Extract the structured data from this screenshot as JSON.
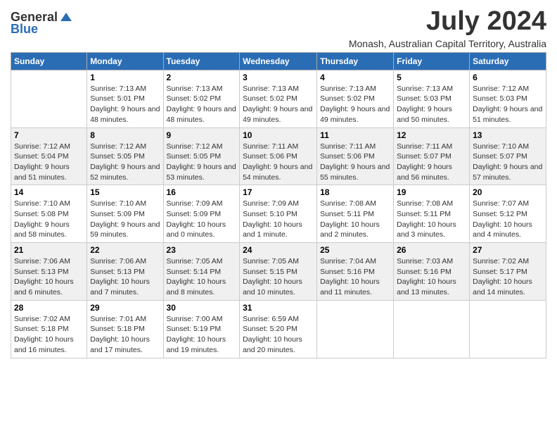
{
  "logo": {
    "general": "General",
    "blue": "Blue"
  },
  "title": "July 2024",
  "subtitle": "Monash, Australian Capital Territory, Australia",
  "days_of_week": [
    "Sunday",
    "Monday",
    "Tuesday",
    "Wednesday",
    "Thursday",
    "Friday",
    "Saturday"
  ],
  "weeks": [
    [
      {
        "day": "",
        "sunrise": "",
        "sunset": "",
        "daylight": ""
      },
      {
        "day": "1",
        "sunrise": "Sunrise: 7:13 AM",
        "sunset": "Sunset: 5:01 PM",
        "daylight": "Daylight: 9 hours and 48 minutes."
      },
      {
        "day": "2",
        "sunrise": "Sunrise: 7:13 AM",
        "sunset": "Sunset: 5:02 PM",
        "daylight": "Daylight: 9 hours and 48 minutes."
      },
      {
        "day": "3",
        "sunrise": "Sunrise: 7:13 AM",
        "sunset": "Sunset: 5:02 PM",
        "daylight": "Daylight: 9 hours and 49 minutes."
      },
      {
        "day": "4",
        "sunrise": "Sunrise: 7:13 AM",
        "sunset": "Sunset: 5:02 PM",
        "daylight": "Daylight: 9 hours and 49 minutes."
      },
      {
        "day": "5",
        "sunrise": "Sunrise: 7:13 AM",
        "sunset": "Sunset: 5:03 PM",
        "daylight": "Daylight: 9 hours and 50 minutes."
      },
      {
        "day": "6",
        "sunrise": "Sunrise: 7:12 AM",
        "sunset": "Sunset: 5:03 PM",
        "daylight": "Daylight: 9 hours and 51 minutes."
      }
    ],
    [
      {
        "day": "7",
        "sunrise": "Sunrise: 7:12 AM",
        "sunset": "Sunset: 5:04 PM",
        "daylight": "Daylight: 9 hours and 51 minutes."
      },
      {
        "day": "8",
        "sunrise": "Sunrise: 7:12 AM",
        "sunset": "Sunset: 5:05 PM",
        "daylight": "Daylight: 9 hours and 52 minutes."
      },
      {
        "day": "9",
        "sunrise": "Sunrise: 7:12 AM",
        "sunset": "Sunset: 5:05 PM",
        "daylight": "Daylight: 9 hours and 53 minutes."
      },
      {
        "day": "10",
        "sunrise": "Sunrise: 7:11 AM",
        "sunset": "Sunset: 5:06 PM",
        "daylight": "Daylight: 9 hours and 54 minutes."
      },
      {
        "day": "11",
        "sunrise": "Sunrise: 7:11 AM",
        "sunset": "Sunset: 5:06 PM",
        "daylight": "Daylight: 9 hours and 55 minutes."
      },
      {
        "day": "12",
        "sunrise": "Sunrise: 7:11 AM",
        "sunset": "Sunset: 5:07 PM",
        "daylight": "Daylight: 9 hours and 56 minutes."
      },
      {
        "day": "13",
        "sunrise": "Sunrise: 7:10 AM",
        "sunset": "Sunset: 5:07 PM",
        "daylight": "Daylight: 9 hours and 57 minutes."
      }
    ],
    [
      {
        "day": "14",
        "sunrise": "Sunrise: 7:10 AM",
        "sunset": "Sunset: 5:08 PM",
        "daylight": "Daylight: 9 hours and 58 minutes."
      },
      {
        "day": "15",
        "sunrise": "Sunrise: 7:10 AM",
        "sunset": "Sunset: 5:09 PM",
        "daylight": "Daylight: 9 hours and 59 minutes."
      },
      {
        "day": "16",
        "sunrise": "Sunrise: 7:09 AM",
        "sunset": "Sunset: 5:09 PM",
        "daylight": "Daylight: 10 hours and 0 minutes."
      },
      {
        "day": "17",
        "sunrise": "Sunrise: 7:09 AM",
        "sunset": "Sunset: 5:10 PM",
        "daylight": "Daylight: 10 hours and 1 minute."
      },
      {
        "day": "18",
        "sunrise": "Sunrise: 7:08 AM",
        "sunset": "Sunset: 5:11 PM",
        "daylight": "Daylight: 10 hours and 2 minutes."
      },
      {
        "day": "19",
        "sunrise": "Sunrise: 7:08 AM",
        "sunset": "Sunset: 5:11 PM",
        "daylight": "Daylight: 10 hours and 3 minutes."
      },
      {
        "day": "20",
        "sunrise": "Sunrise: 7:07 AM",
        "sunset": "Sunset: 5:12 PM",
        "daylight": "Daylight: 10 hours and 4 minutes."
      }
    ],
    [
      {
        "day": "21",
        "sunrise": "Sunrise: 7:06 AM",
        "sunset": "Sunset: 5:13 PM",
        "daylight": "Daylight: 10 hours and 6 minutes."
      },
      {
        "day": "22",
        "sunrise": "Sunrise: 7:06 AM",
        "sunset": "Sunset: 5:13 PM",
        "daylight": "Daylight: 10 hours and 7 minutes."
      },
      {
        "day": "23",
        "sunrise": "Sunrise: 7:05 AM",
        "sunset": "Sunset: 5:14 PM",
        "daylight": "Daylight: 10 hours and 8 minutes."
      },
      {
        "day": "24",
        "sunrise": "Sunrise: 7:05 AM",
        "sunset": "Sunset: 5:15 PM",
        "daylight": "Daylight: 10 hours and 10 minutes."
      },
      {
        "day": "25",
        "sunrise": "Sunrise: 7:04 AM",
        "sunset": "Sunset: 5:16 PM",
        "daylight": "Daylight: 10 hours and 11 minutes."
      },
      {
        "day": "26",
        "sunrise": "Sunrise: 7:03 AM",
        "sunset": "Sunset: 5:16 PM",
        "daylight": "Daylight: 10 hours and 13 minutes."
      },
      {
        "day": "27",
        "sunrise": "Sunrise: 7:02 AM",
        "sunset": "Sunset: 5:17 PM",
        "daylight": "Daylight: 10 hours and 14 minutes."
      }
    ],
    [
      {
        "day": "28",
        "sunrise": "Sunrise: 7:02 AM",
        "sunset": "Sunset: 5:18 PM",
        "daylight": "Daylight: 10 hours and 16 minutes."
      },
      {
        "day": "29",
        "sunrise": "Sunrise: 7:01 AM",
        "sunset": "Sunset: 5:18 PM",
        "daylight": "Daylight: 10 hours and 17 minutes."
      },
      {
        "day": "30",
        "sunrise": "Sunrise: 7:00 AM",
        "sunset": "Sunset: 5:19 PM",
        "daylight": "Daylight: 10 hours and 19 minutes."
      },
      {
        "day": "31",
        "sunrise": "Sunrise: 6:59 AM",
        "sunset": "Sunset: 5:20 PM",
        "daylight": "Daylight: 10 hours and 20 minutes."
      },
      {
        "day": "",
        "sunrise": "",
        "sunset": "",
        "daylight": ""
      },
      {
        "day": "",
        "sunrise": "",
        "sunset": "",
        "daylight": ""
      },
      {
        "day": "",
        "sunrise": "",
        "sunset": "",
        "daylight": ""
      }
    ]
  ]
}
